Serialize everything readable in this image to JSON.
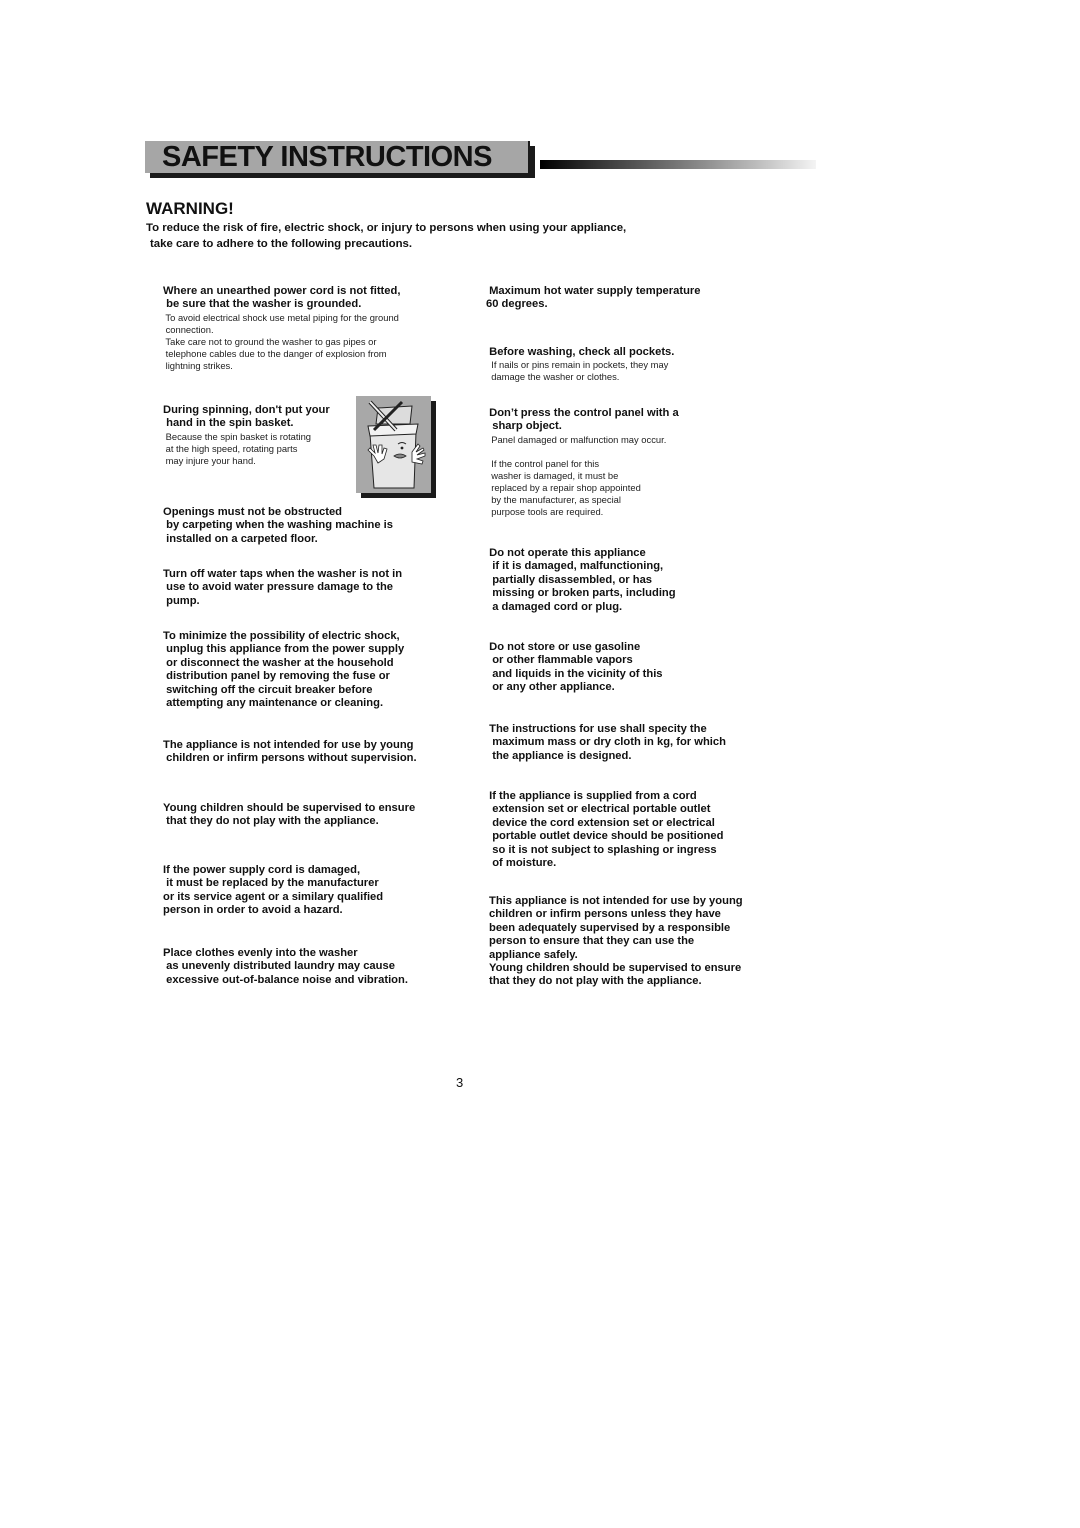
{
  "header": {
    "title": "SAFETY INSTRUCTIONS"
  },
  "warning": {
    "heading": "WARNING!",
    "intro_lines": [
      "To reduce the risk of fire, electric shock, or injury to persons when using your appliance,",
      "take care to adhere to the following precautions."
    ]
  },
  "left_column": [
    {
      "head": [
        "Where an unearthed power cord is not fitted,",
        " be sure that the washer is grounded."
      ],
      "sub": [
        " To avoid electrical shock use metal piping for the ground",
        " connection.",
        " Take care not to ground the washer to gas pipes or",
        " telephone cables due to the danger of explosion from",
        " lightning strikes."
      ]
    },
    {
      "head": [
        "During spinning, don't put your",
        " hand in the spin basket."
      ],
      "sub": [
        " Because the spin basket is rotating",
        " at the high speed, rotating parts",
        " may injure your hand."
      ]
    },
    {
      "head": [
        "Openings must not be obstructed",
        " by carpeting when the washing machine is",
        " installed on a carpeted floor."
      ],
      "sub": []
    },
    {
      "head": [
        "Turn off water taps when the washer is not in",
        " use to avoid water pressure damage to the",
        " pump."
      ],
      "sub": []
    },
    {
      "head": [
        "To minimize the possibility of electric shock,",
        " unplug this appliance from the power supply",
        " or disconnect the washer at the household",
        " distribution panel by removing the fuse or",
        " switching off the circuit breaker before",
        " attempting any maintenance or cleaning."
      ],
      "sub": []
    },
    {
      "head": [
        "The appliance is not intended for use by young",
        " children or infirm persons without supervision."
      ],
      "sub": []
    },
    {
      "head": [
        "Young children should be supervised to ensure",
        " that they do not play with the appliance."
      ],
      "sub": []
    },
    {
      "head": [
        "If the power supply cord is damaged,",
        " it must be replaced by the manufacturer",
        "or its service agent or a similary qualified",
        "person in order to avoid a hazard."
      ],
      "sub": []
    },
    {
      "head": [
        "Place clothes evenly into the washer",
        " as unevenly distributed laundry may cause",
        " excessive out-of-balance noise and vibration."
      ],
      "sub": []
    }
  ],
  "right_column": [
    {
      "head": [
        " Maximum hot water supply temperature",
        "60 degrees."
      ],
      "sub": []
    },
    {
      "head": [
        " Before washing, check all pockets."
      ],
      "sub": [
        "  If nails or pins remain in pockets, they may",
        "  damage the washer or clothes."
      ]
    },
    {
      "head": [
        " Don’t press the control panel with a",
        "  sharp object."
      ],
      "sub": [
        "  Panel damaged or malfunction may occur.",
        " ",
        "  If the control panel for this",
        "  washer is damaged, it must be",
        "  replaced by a repair shop appointed",
        "  by the manufacturer, as special",
        "  purpose tools are required."
      ]
    },
    {
      "head": [
        " Do not operate this appliance",
        "  if it is damaged, malfunctioning,",
        "  partially disassembled, or has",
        "  missing or broken parts, including",
        "  a damaged cord or plug."
      ],
      "sub": []
    },
    {
      "head": [
        " Do not store or use gasoline",
        "  or other flammable vapors",
        "  and liquids in the vicinity of this",
        "  or any other appliance."
      ],
      "sub": []
    },
    {
      "head": [
        " The instructions for use shall specity the",
        "  maximum mass or dry cloth in kg, for which",
        "  the appliance is designed."
      ],
      "sub": []
    },
    {
      "head": [
        " If the appliance is supplied from a cord",
        "  extension set or electrical portable outlet",
        "  device the cord extension set or electrical",
        "  portable outlet device should be positioned",
        "  so it is not subject to splashing or ingress",
        "  of moisture."
      ],
      "sub": []
    },
    {
      "head": [
        "This appliance is not intended for use by young",
        "children or infirm persons unless they have",
        "been adequately supervised by a responsible",
        "person to ensure that they can use the",
        "appliance safely.",
        "Young children should be supervised to ensure",
        "that they do not play with the appliance."
      ],
      "sub": []
    }
  ],
  "illustration": {
    "icon": "washer-hand-warning-icon",
    "description": "Cartoon washing machine with crossed-out hand"
  },
  "footer": {
    "page_number": "3"
  }
}
